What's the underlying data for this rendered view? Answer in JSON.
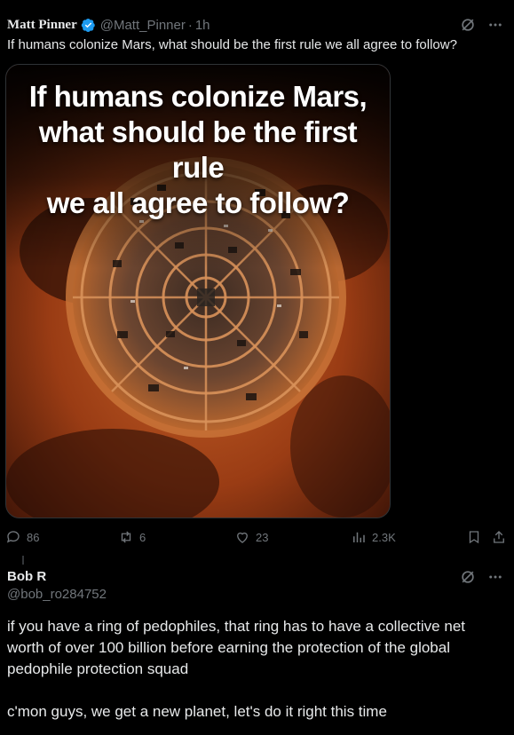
{
  "post": {
    "author_name": "Matt Pinner",
    "handle": "@Matt_Pinner",
    "separator": "·",
    "time": "1h",
    "text": "If humans colonize Mars, what should be the first rule we all agree to follow?",
    "image": {
      "title_lines": [
        "If humans colonize Mars,",
        "what should be the first rule",
        "we all agree to follow?"
      ]
    },
    "actions": {
      "replies": "86",
      "reposts": "6",
      "likes": "23",
      "views": "2.3K"
    }
  },
  "reply": {
    "author_name": "Bob R",
    "handle": "@bob_ro284752",
    "paragraphs": [
      "if you have a ring of pedophiles, that ring has to have a collective net worth of over 100 billion before earning the protection of the global pedophile protection squad",
      "c'mon guys, we get a new planet, let's do it right this time"
    ]
  },
  "colors": {
    "background": "#000000",
    "text": "#e7e9ea",
    "muted": "#71767b",
    "verified": "#1d9bf0"
  },
  "icons": [
    "verified-badge-icon",
    "grok-icon",
    "more-icon",
    "reply-icon",
    "repost-icon",
    "like-icon",
    "views-icon",
    "bookmark-icon",
    "share-icon"
  ]
}
